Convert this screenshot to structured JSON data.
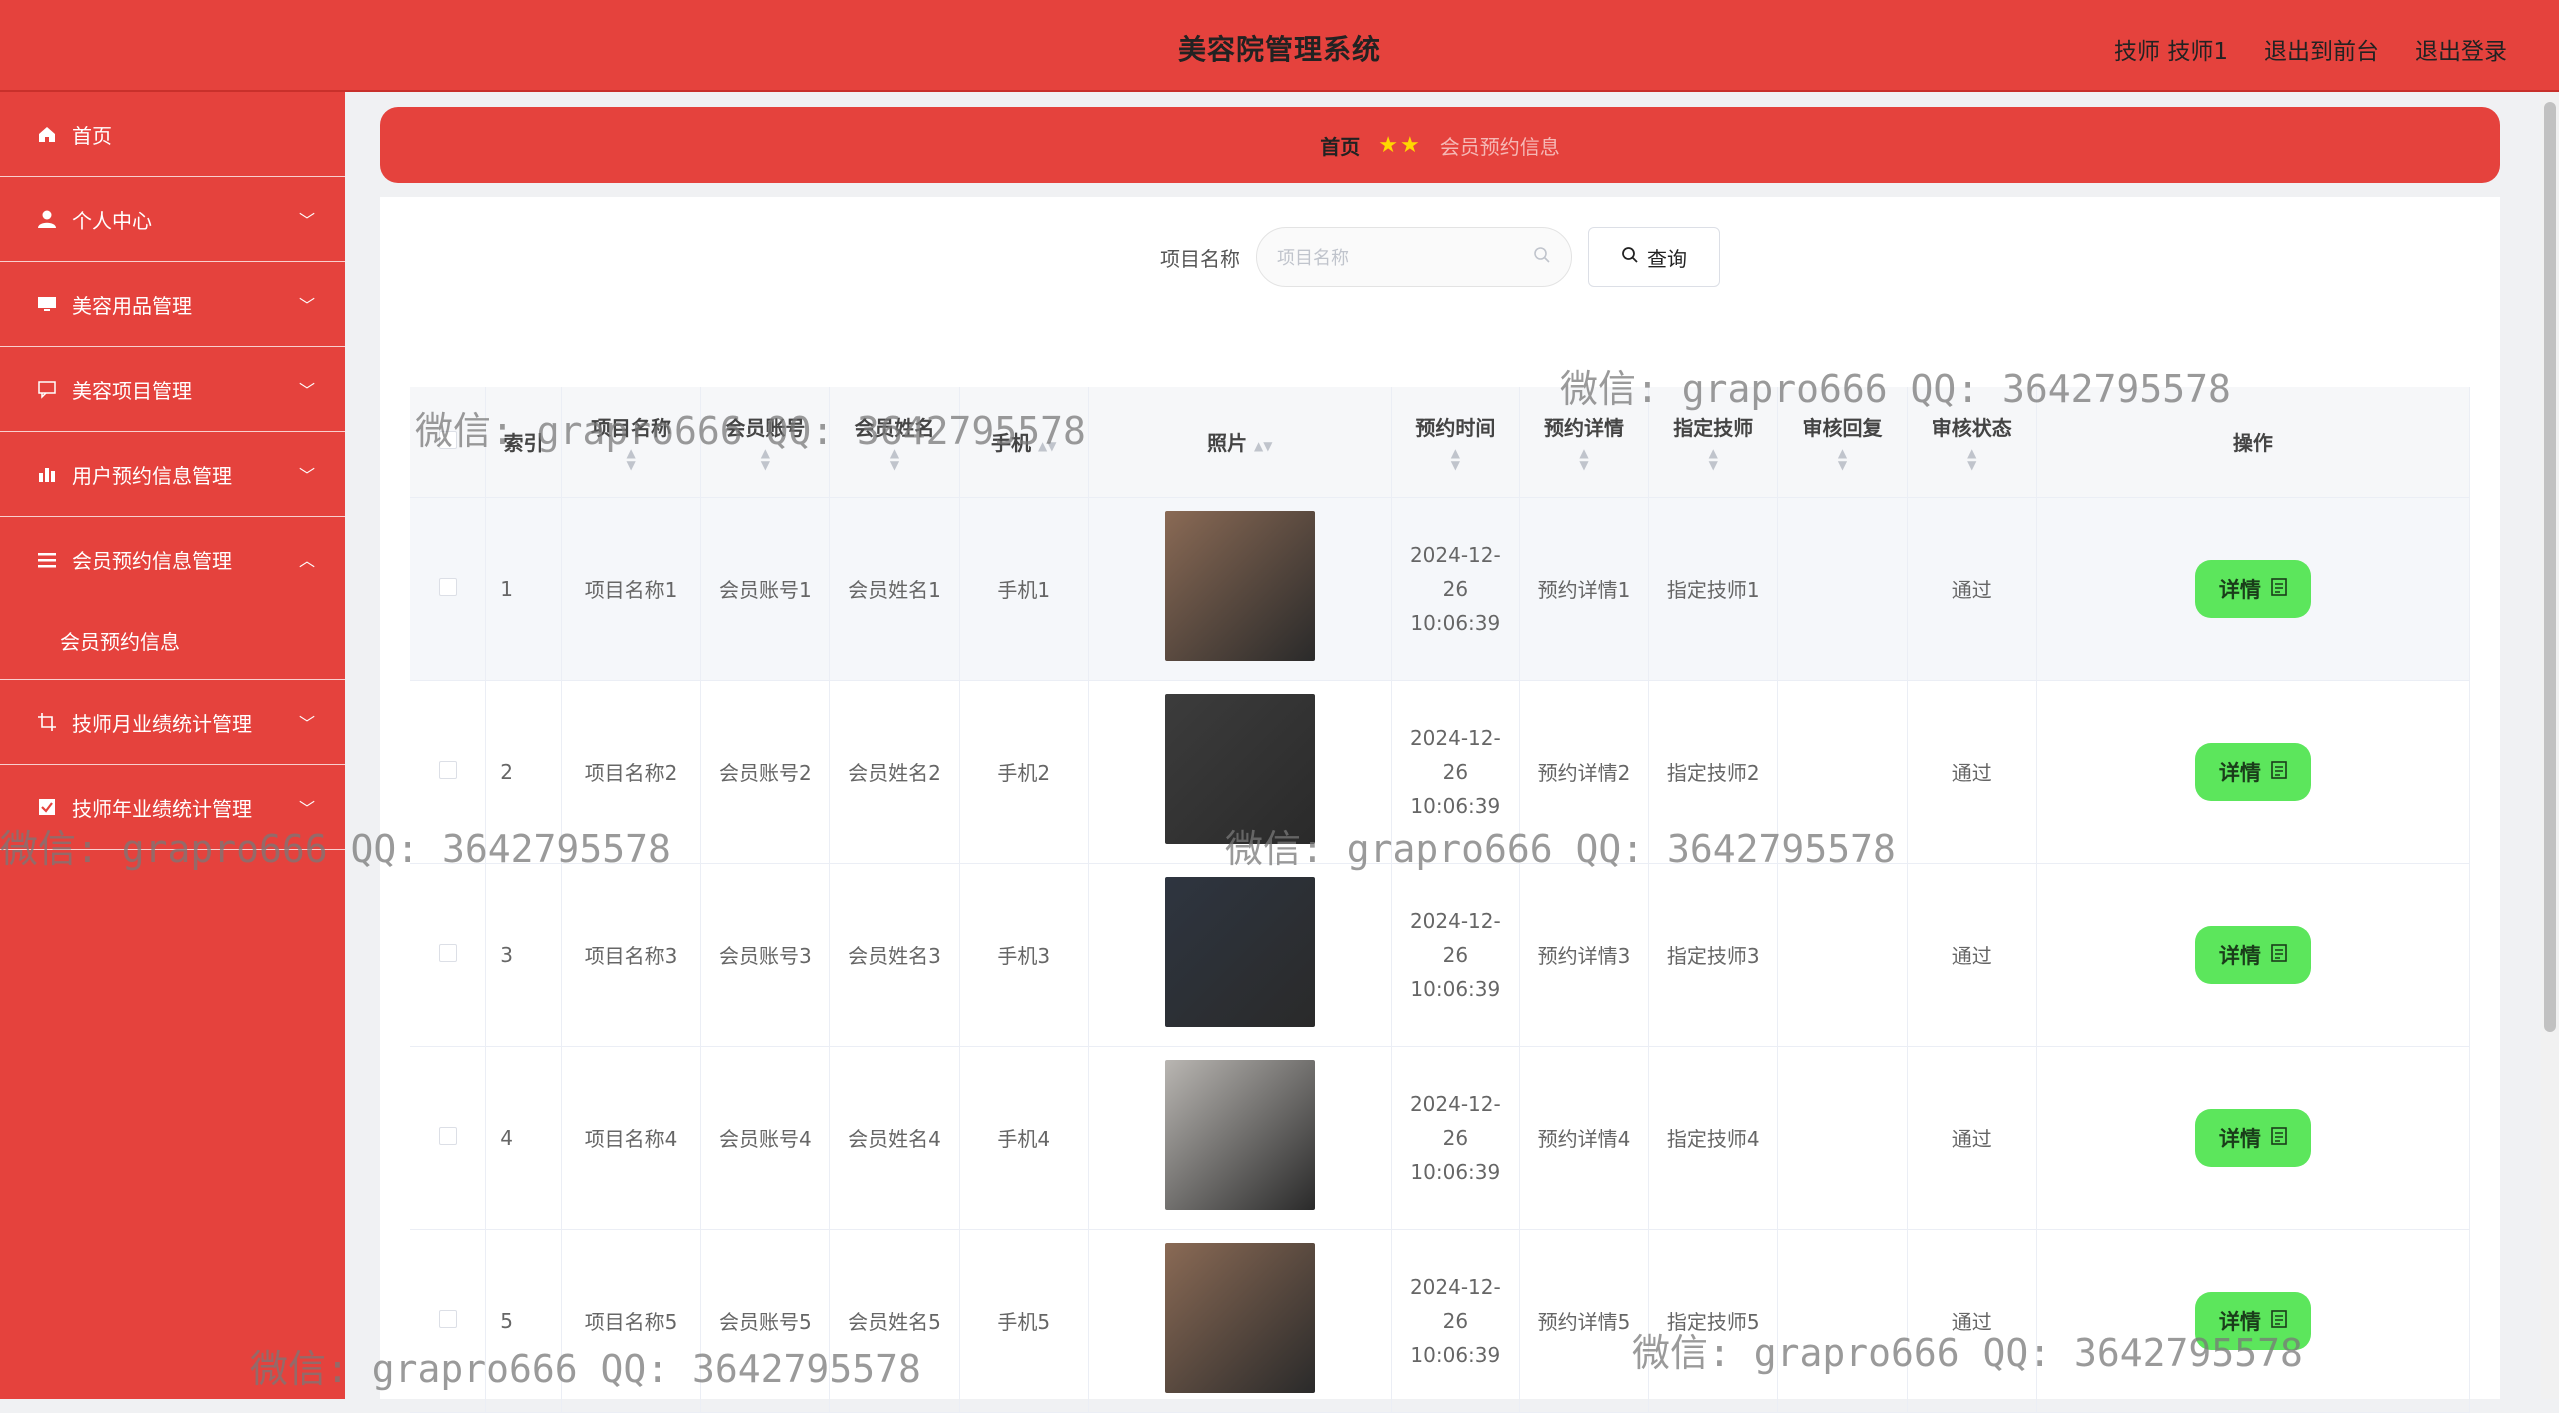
{
  "header": {
    "title": "美容院管理系统",
    "user_label": "技师 技师1",
    "front_link": "退出到前台",
    "logout_link": "退出登录"
  },
  "sidebar": {
    "items": [
      {
        "label": "首页",
        "icon": "home-icon"
      },
      {
        "label": "个人中心",
        "icon": "user-icon"
      },
      {
        "label": "美容用品管理",
        "icon": "monitor-icon"
      },
      {
        "label": "美容项目管理",
        "icon": "chat-icon"
      },
      {
        "label": "用户预约信息管理",
        "icon": "bar-chart-icon"
      },
      {
        "label": "会员预约信息管理",
        "icon": "list-icon"
      },
      {
        "label": "技师月业绩统计管理",
        "icon": "crop-icon"
      },
      {
        "label": "技师年业绩统计管理",
        "icon": "checkbox-icon"
      }
    ],
    "subitem": "会员预约信息"
  },
  "breadcrumb": {
    "home": "首页",
    "current": "会员预约信息"
  },
  "search": {
    "label": "项目名称",
    "placeholder": "项目名称",
    "button": "查询"
  },
  "table": {
    "columns": [
      "索引",
      "项目名称",
      "会员账号",
      "会员姓名",
      "手机",
      "照片",
      "预约时间",
      "预约详情",
      "指定技师",
      "审核回复",
      "审核状态",
      "操作"
    ],
    "rows": [
      {
        "index": "1",
        "project": "项目名称1",
        "account": "会员账号1",
        "name": "会员姓名1",
        "phone": "手机1",
        "time": "2024-12-26 10:06:39",
        "detail": "预约详情1",
        "tech": "指定技师1",
        "reply": "",
        "status": "通过",
        "photo_color": "#8a6a55"
      },
      {
        "index": "2",
        "project": "项目名称2",
        "account": "会员账号2",
        "name": "会员姓名2",
        "phone": "手机2",
        "time": "2024-12-26 10:06:39",
        "detail": "预约详情2",
        "tech": "指定技师2",
        "reply": "",
        "status": "通过",
        "photo_color": "#3c3c3c"
      },
      {
        "index": "3",
        "project": "项目名称3",
        "account": "会员账号3",
        "name": "会员姓名3",
        "phone": "手机3",
        "time": "2024-12-26 10:06:39",
        "detail": "预约详情3",
        "tech": "指定技师3",
        "reply": "",
        "status": "通过",
        "photo_color": "#2e3540"
      },
      {
        "index": "4",
        "project": "项目名称4",
        "account": "会员账号4",
        "name": "会员姓名4",
        "phone": "手机4",
        "time": "2024-12-26 10:06:39",
        "detail": "预约详情4",
        "tech": "指定技师4",
        "reply": "",
        "status": "通过",
        "photo_color": "#b9b6b2"
      },
      {
        "index": "5",
        "project": "项目名称5",
        "account": "会员账号5",
        "name": "会员姓名5",
        "phone": "手机5",
        "time": "2024-12-26 10:06:39",
        "detail": "预约详情5",
        "tech": "指定技师5",
        "reply": "",
        "status": "通过",
        "photo_color": "#8a6a55"
      }
    ],
    "detail_button": "详情"
  },
  "watermark": "微信: grapro666 QQ: 3642795578",
  "colors": {
    "brand": "#e5423d",
    "detail_button": "#5ce65c"
  }
}
